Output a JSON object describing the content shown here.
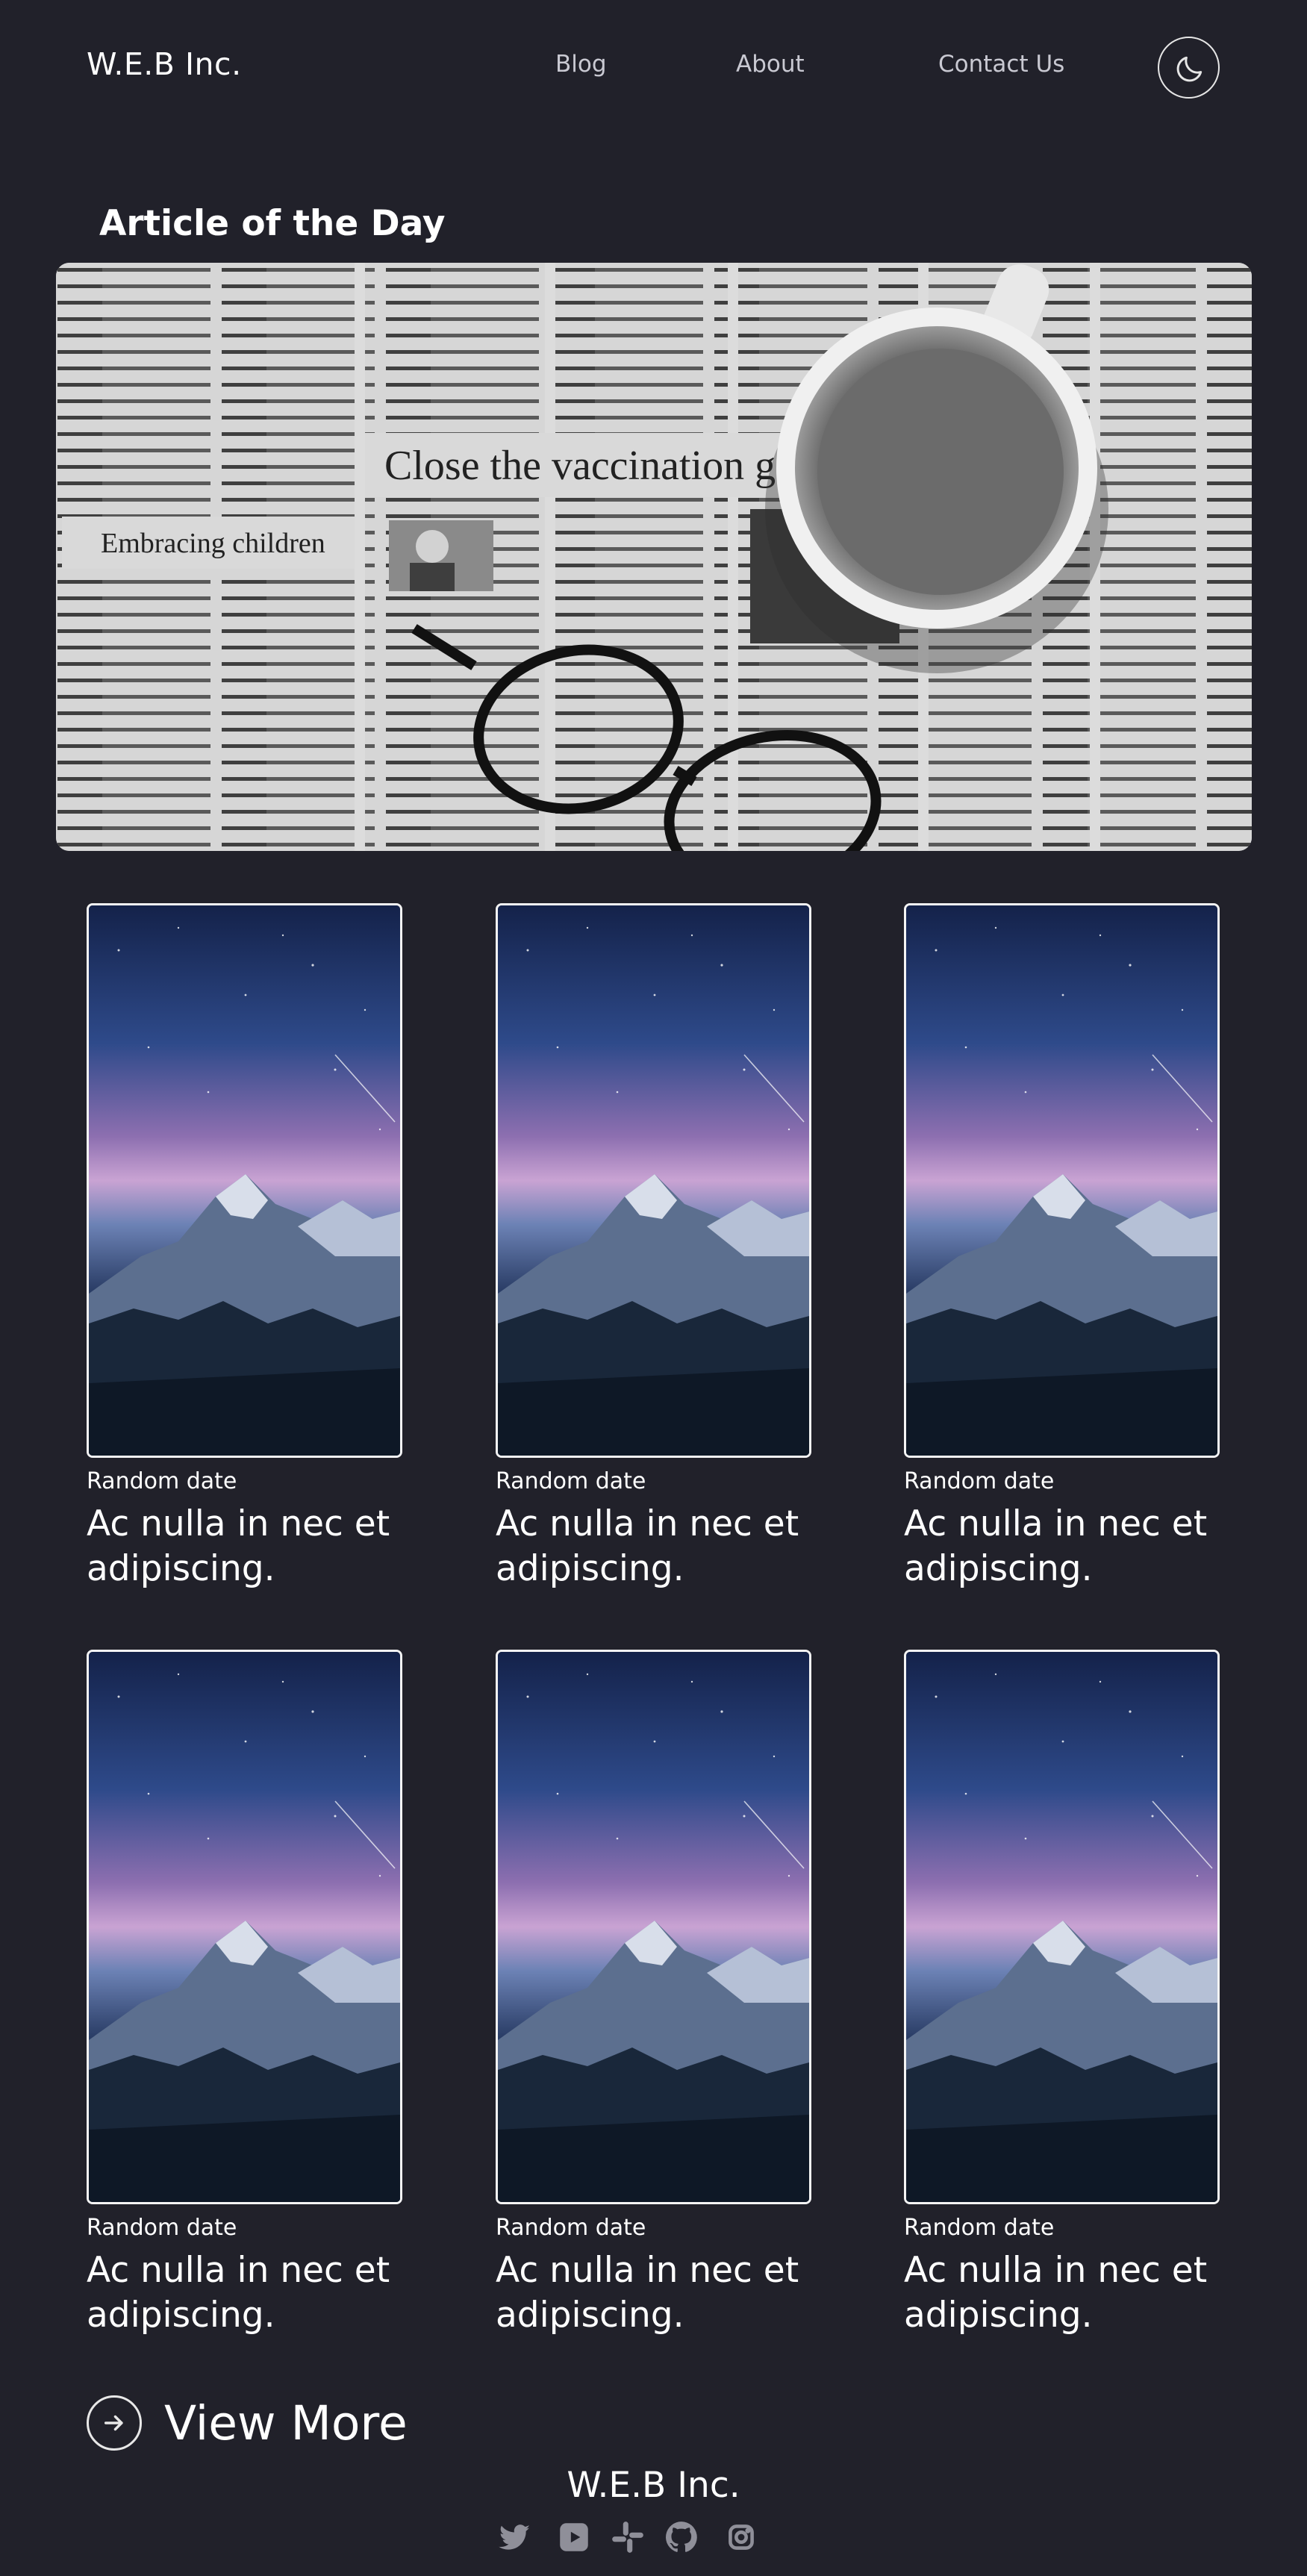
{
  "header": {
    "brand": "W.E.B Inc.",
    "nav": [
      {
        "label": "Blog"
      },
      {
        "label": "About"
      },
      {
        "label": "Contact Us"
      }
    ],
    "theme_toggle_icon": "moon-icon"
  },
  "article_of_day": {
    "heading": "Article of the Day",
    "image_icon": "newspaper-coffee-photo",
    "newspaper_headlines": [
      "Close the vaccination g",
      "Embracing children"
    ]
  },
  "cards": [
    {
      "date": "Random date",
      "title": "Ac nulla in nec et adipiscing."
    },
    {
      "date": "Random date",
      "title": "Ac nulla in nec et adipiscing."
    },
    {
      "date": "Random date",
      "title": "Ac nulla in nec et adipiscing."
    },
    {
      "date": "Random date",
      "title": "Ac nulla in nec et adipiscing."
    },
    {
      "date": "Random date",
      "title": "Ac nulla in nec et adipiscing."
    },
    {
      "date": "Random date",
      "title": "Ac nulla in nec et adipiscing."
    }
  ],
  "view_more": {
    "label": "View More",
    "icon": "arrow-right-circle-icon"
  },
  "footer": {
    "brand": "W.E.B Inc.",
    "social_icons": [
      "twitter-icon",
      "youtube-icon",
      "slack-icon",
      "github-icon",
      "instagram-icon"
    ]
  },
  "colors": {
    "background": "#21212a",
    "text": "#ffffff",
    "nav_text": "#c9c9d2",
    "card_border": "#f4f4f4"
  }
}
